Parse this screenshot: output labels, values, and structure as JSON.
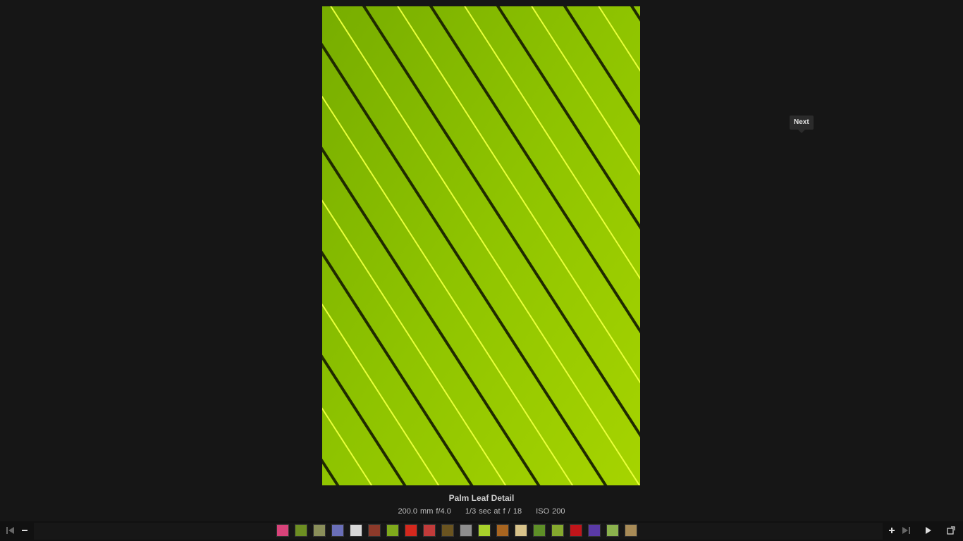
{
  "viewer": {
    "image_title": "Palm Leaf Detail",
    "exif": {
      "focal": "200.0 mm f/4.0",
      "exposure": "1/3 sec at f / 18",
      "iso": "ISO 200"
    },
    "tooltip": "Next"
  },
  "controls": {
    "left": [
      "first-icon",
      "zoom-out-icon"
    ],
    "right": [
      "zoom-in-icon",
      "last-icon",
      "play-icon",
      "fullscreen-icon"
    ]
  },
  "thumbnails": [
    {
      "name": "thumb-1",
      "color": "#d8437a"
    },
    {
      "name": "thumb-2",
      "color": "#6d8f22"
    },
    {
      "name": "thumb-3",
      "color": "#8a8f5a"
    },
    {
      "name": "thumb-4",
      "color": "#6a6fb8"
    },
    {
      "name": "thumb-5",
      "color": "#d8d8d8"
    },
    {
      "name": "thumb-6",
      "color": "#8c3a2a"
    },
    {
      "name": "thumb-7",
      "color": "#7faa1c"
    },
    {
      "name": "thumb-8",
      "color": "#d5281d"
    },
    {
      "name": "thumb-9",
      "color": "#c13b3a"
    },
    {
      "name": "thumb-10",
      "color": "#6a5420"
    },
    {
      "name": "thumb-11",
      "color": "#8e8e8e"
    },
    {
      "name": "thumb-12",
      "color": "#a8d12b"
    },
    {
      "name": "thumb-13",
      "color": "#a86520"
    },
    {
      "name": "thumb-14",
      "color": "#d8c38a"
    },
    {
      "name": "thumb-15",
      "color": "#5e8f27"
    },
    {
      "name": "thumb-16",
      "color": "#85a92e"
    },
    {
      "name": "thumb-17",
      "color": "#c0151a"
    },
    {
      "name": "thumb-18",
      "color": "#5a3aa6"
    },
    {
      "name": "thumb-19",
      "color": "#8bb24d"
    },
    {
      "name": "thumb-20",
      "color": "#a88b57"
    }
  ]
}
